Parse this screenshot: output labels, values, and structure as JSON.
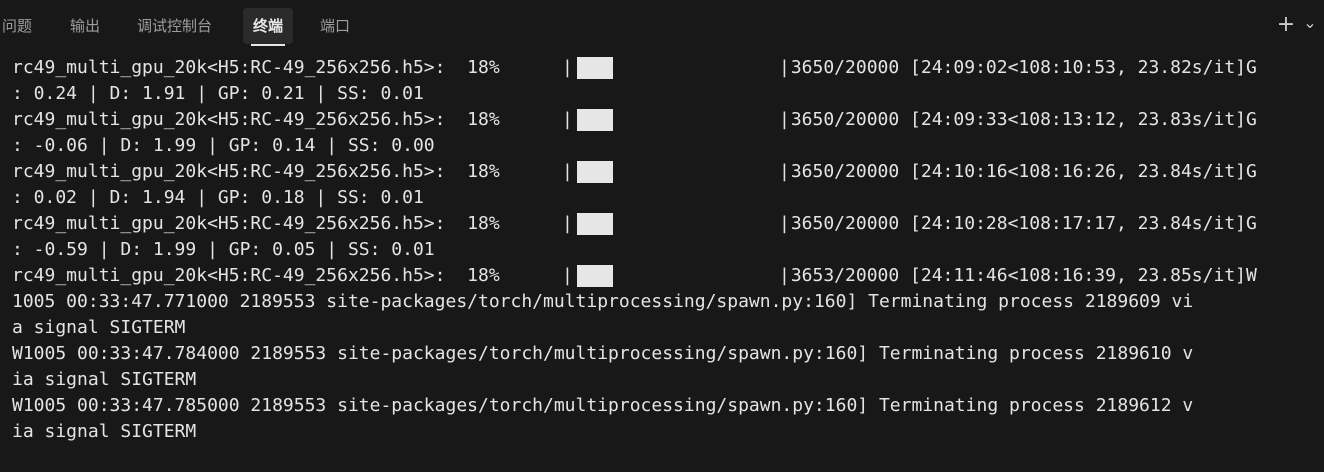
{
  "tabs": [
    {
      "label": "问题"
    },
    {
      "label": "输出"
    },
    {
      "label": "调试控制台"
    },
    {
      "label": "终端",
      "active": true
    },
    {
      "label": "端口"
    }
  ],
  "toolbar": {
    "add_icon": "plus-icon",
    "add_glyph": "+",
    "dropdown_icon": "chevron-down-icon",
    "dropdown_glyph": "⌄"
  },
  "colors": {
    "background": "#181818",
    "text": "#e4e4e4",
    "progress_fill": "#e6e6e6"
  },
  "terminal": {
    "progress_rows": [
      {
        "prefix": "rc49_multi_gpu_20k<H5:RC-49_256x256.h5>:  18%",
        "fraction": 0.18,
        "suffix": " 3650/20000 [24:09:02<108:10:53, 23.82s/it]G",
        "wrap": ": 0.24 | D: 1.91 | GP: 0.21 | SS: 0.01"
      },
      {
        "prefix": "rc49_multi_gpu_20k<H5:RC-49_256x256.h5>:  18%",
        "fraction": 0.18,
        "suffix": " 3650/20000 [24:09:33<108:13:12, 23.83s/it]G",
        "wrap": ": -0.06 | D: 1.99 | GP: 0.14 | SS: 0.00"
      },
      {
        "prefix": "rc49_multi_gpu_20k<H5:RC-49_256x256.h5>:  18%",
        "fraction": 0.18,
        "suffix": " 3650/20000 [24:10:16<108:16:26, 23.84s/it]G",
        "wrap": ": 0.02 | D: 1.94 | GP: 0.18 | SS: 0.01"
      },
      {
        "prefix": "rc49_multi_gpu_20k<H5:RC-49_256x256.h5>:  18%",
        "fraction": 0.18,
        "suffix": " 3650/20000 [24:10:28<108:17:17, 23.84s/it]G",
        "wrap": ": -0.59 | D: 1.99 | GP: 0.05 | SS: 0.01"
      },
      {
        "prefix": "rc49_multi_gpu_20k<H5:RC-49_256x256.h5>:  18%",
        "fraction": 0.18,
        "suffix": " 3653/20000 [24:11:46<108:16:39, 23.85s/it]W"
      }
    ],
    "log_lines": [
      "1005 00:33:47.771000 2189553 site-packages/torch/multiprocessing/spawn.py:160] Terminating process 2189609 vi",
      "a signal SIGTERM",
      "W1005 00:33:47.784000 2189553 site-packages/torch/multiprocessing/spawn.py:160] Terminating process 2189610 v",
      "ia signal SIGTERM",
      "W1005 00:33:47.785000 2189553 site-packages/torch/multiprocessing/spawn.py:160] Terminating process 2189612 v",
      "ia signal SIGTERM"
    ]
  }
}
